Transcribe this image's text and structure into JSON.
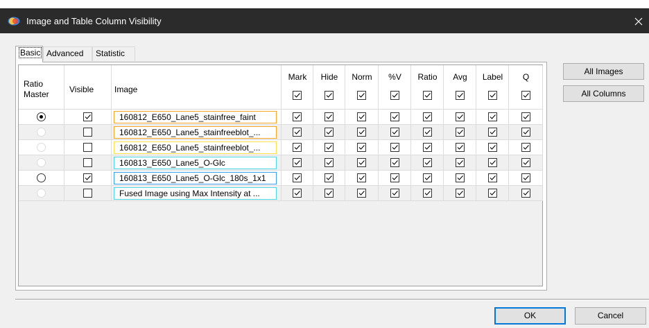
{
  "window": {
    "title": "Image and Table Column Visibility"
  },
  "tabs": [
    {
      "label": "Basic"
    },
    {
      "label": "Advanced"
    },
    {
      "label": "Statistic"
    }
  ],
  "columns": {
    "ratio_master": "Ratio\nMaster",
    "visible": "Visible",
    "image": "Image",
    "checks": [
      {
        "label": "Mark",
        "checked": true
      },
      {
        "label": "Hide",
        "checked": true
      },
      {
        "label": "Norm",
        "checked": true
      },
      {
        "label": "%V",
        "checked": true
      },
      {
        "label": "Ratio",
        "checked": true
      },
      {
        "label": "Avg",
        "checked": true
      },
      {
        "label": "Label",
        "checked": true
      },
      {
        "label": "Q",
        "checked": true
      }
    ]
  },
  "rows": [
    {
      "ratio_master": "selected",
      "visible": true,
      "image": "160812_E650_Lane5_stainfree_faint",
      "border_color": "#f5a623"
    },
    {
      "ratio_master": "disabled",
      "visible": false,
      "image": "160812_E650_Lane5_stainfreeblot_...",
      "border_color": "#f5a623"
    },
    {
      "ratio_master": "disabled",
      "visible": false,
      "image": "160812_E650_Lane5_stainfreeblot_...",
      "border_color": "#ffe14d"
    },
    {
      "ratio_master": "disabled",
      "visible": false,
      "image": "160813_E650_Lane5_O-Glc",
      "border_color": "#4dd9e8"
    },
    {
      "ratio_master": "enabled",
      "visible": true,
      "image": "160813_E650_Lane5_O-Glc_180s_1x1",
      "border_color": "#3aa0f0"
    },
    {
      "ratio_master": "disabled",
      "visible": false,
      "image": "Fused Image using Max Intensity at ...",
      "border_color": "#4dd9e8"
    }
  ],
  "side_buttons": {
    "all_images": "All Images",
    "all_columns": "All Columns"
  },
  "footer": {
    "ok": "OK",
    "cancel": "Cancel"
  },
  "colors": {
    "titlebar": "#2b2b2b",
    "dialog_bg": "#f0f0f0",
    "row_alt": "#f0f0f0",
    "default_button_border": "#0078d7"
  }
}
